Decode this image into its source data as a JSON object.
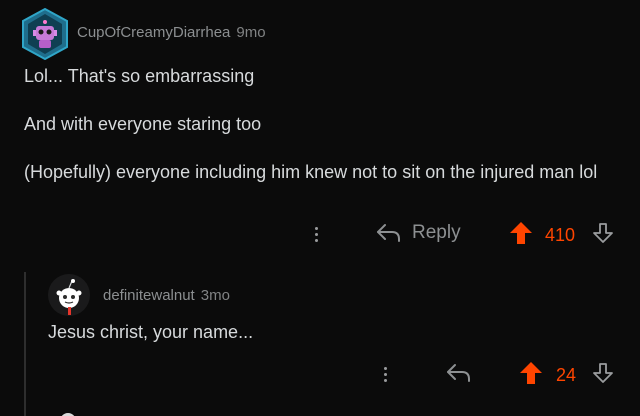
{
  "comment": {
    "username": "CupOfCreamyDiarrhea",
    "age": "9mo",
    "lines": [
      "Lol... That's so embarrassing",
      "And with everyone staring too",
      "(Hopefully) everyone including him knew not to sit on the injured man lol"
    ],
    "reply_label": "Reply",
    "score": "410"
  },
  "reply": {
    "username": "definitewalnut",
    "age": "3mo",
    "text": "Jesus christ, your name...",
    "score": "24"
  },
  "colors": {
    "background": "#0b0b0b",
    "upvote_active": "#ff4500",
    "text": "#d7dadc",
    "meta": "#8c8f91"
  },
  "icons": {
    "more": "more-icon",
    "reply": "reply-arrow-icon",
    "upvote": "upvote-arrow-icon",
    "downvote": "downvote-arrow-icon"
  }
}
